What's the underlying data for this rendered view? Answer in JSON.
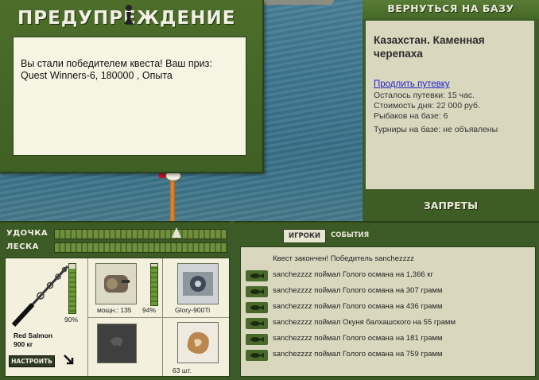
{
  "dialog": {
    "title": "ПРЕДУПРЕЖДЕНИЕ",
    "message": "Вы стали победителем квеста! Ваш приз: Quest Winners-6, 180000 , Опыта"
  },
  "base_panel": {
    "back_button": "ВЕРНУТЬСЯ НА БАЗУ",
    "location": "Казахстан. Каменная черепаха",
    "extend_link": "Продлить путевку",
    "time_left": "Осталось путевки: 15 час.",
    "day_cost": "Стоимость дня: 22 000 руб.",
    "anglers": "Рыбаков на базе: 6",
    "tournaments": "Турниры на базе: не объявлены",
    "bans_button": "ЗАПРЕТЫ"
  },
  "tackle": {
    "rod_label": "УДОЧКА",
    "line_label": "ЛЕСКА",
    "rod_name": "Red Salmon",
    "rod_capacity": "900 кг",
    "rod_wear": "90%",
    "rod_wear_fraction": 0.9,
    "reel_power": "мощн.: 135",
    "reel_wear": "94%",
    "reel_wear_fraction": 0.94,
    "line_name": "Glory-900Ti",
    "bait_count": "63 шт.",
    "setup_button": "НАСТРОИТЬ"
  },
  "events_panel": {
    "tab_players": "ИГРОКИ",
    "tab_events": "СОБЫТИЯ",
    "log": [
      "Квест закончен! Победитель sanchezzzz",
      "sanchezzzz поймал Голого османа на 1,366 кг",
      "sanchezzzz поймал Голого османа на 307 грамм",
      "sanchezzzz поймал Голого османа на 436 грамм",
      "sanchezzzz поймал Окуня балхашского на 55 грамм",
      "sanchezzzz поймал Голого османа на 181 грамм",
      "sanchezzzz поймал Голого османа на 759 грамм"
    ]
  },
  "colors": {
    "panel_green": "#3c5a25",
    "info_bg": "#d9d8bf",
    "dialog_bg": "#f6f4e2",
    "link": "#2222cc"
  }
}
